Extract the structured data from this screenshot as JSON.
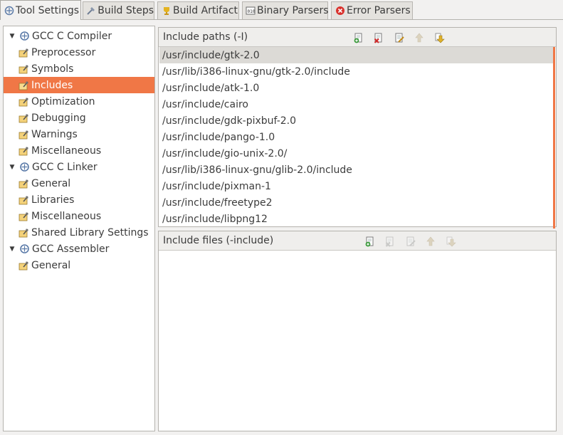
{
  "tabs": [
    {
      "label": "Tool Settings",
      "icon": "tool-settings-icon",
      "active": true
    },
    {
      "label": "Build Steps",
      "icon": "build-steps-icon",
      "active": false
    },
    {
      "label": "Build Artifact",
      "icon": "build-artifact-icon",
      "active": false
    },
    {
      "label": "Binary Parsers",
      "icon": "binary-parsers-icon",
      "active": false
    },
    {
      "label": "Error Parsers",
      "icon": "error-parsers-icon",
      "active": false
    }
  ],
  "tree": [
    {
      "label": "GCC C Compiler",
      "type": "tool",
      "expanded": true
    },
    {
      "label": "Preprocessor",
      "type": "option-category"
    },
    {
      "label": "Symbols",
      "type": "option-category"
    },
    {
      "label": "Includes",
      "type": "option-category",
      "selected": true
    },
    {
      "label": "Optimization",
      "type": "option-category"
    },
    {
      "label": "Debugging",
      "type": "option-category"
    },
    {
      "label": "Warnings",
      "type": "option-category"
    },
    {
      "label": "Miscellaneous",
      "type": "option-category"
    },
    {
      "label": "GCC C Linker",
      "type": "tool",
      "expanded": true
    },
    {
      "label": "General",
      "type": "option-category"
    },
    {
      "label": "Libraries",
      "type": "option-category"
    },
    {
      "label": "Miscellaneous",
      "type": "option-category"
    },
    {
      "label": "Shared Library Settings",
      "type": "option-category"
    },
    {
      "label": "GCC Assembler",
      "type": "tool",
      "expanded": true
    },
    {
      "label": "General",
      "type": "option-category"
    }
  ],
  "include_paths": {
    "title": "Include paths (-I)",
    "toolbar": [
      "add-icon",
      "delete-icon",
      "edit-icon",
      "move-up-icon",
      "move-down-icon"
    ],
    "items": [
      "/usr/include/gtk-2.0",
      "/usr/lib/i386-linux-gnu/gtk-2.0/include",
      "/usr/include/atk-1.0",
      "/usr/include/cairo",
      "/usr/include/gdk-pixbuf-2.0",
      "/usr/include/pango-1.0",
      "/usr/include/gio-unix-2.0/",
      "/usr/lib/i386-linux-gnu/glib-2.0/include",
      "/usr/include/pixman-1",
      "/usr/include/freetype2",
      "/usr/include/libpng12"
    ],
    "selected_index": 0
  },
  "include_files": {
    "title": "Include files (-include)",
    "toolbar": [
      "add-icon",
      "delete-icon",
      "edit-icon",
      "move-up-icon",
      "move-down-icon"
    ],
    "items": []
  },
  "colors": {
    "selection_accent": "#f07746",
    "row_selected": "#dcdad6",
    "background": "#f2f1f0"
  }
}
